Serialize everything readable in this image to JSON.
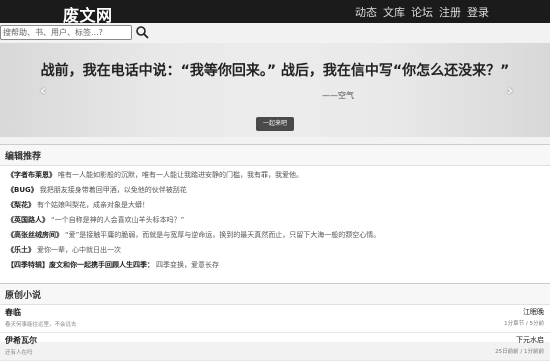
{
  "header": {
    "brand": "废文网",
    "nav": [
      "动态",
      "文库",
      "论坛",
      "注册",
      "登录"
    ]
  },
  "search": {
    "placeholder": "搜帮助、书、用户、标签...?"
  },
  "hero": {
    "quote": "战前，我在电话中说：“我等你回来。” 战后，我在信中写“你怎么还没来？”",
    "author": "——空气",
    "button": "一起来吧",
    "prev_arrow": "‹",
    "next_arrow": "›"
  },
  "recommend": {
    "heading": "编辑推荐",
    "items": [
      {
        "title": "《字者布莱恩》",
        "desc": "唯有一人能如影般的沉默，唯有一人能让我踏进安静的门槛，我有罪，我爱他。"
      },
      {
        "title": "《BUG》",
        "desc": "我把朋友接身带着回甲酒，以免他的伙伴被刮花"
      },
      {
        "title": "《梨花》",
        "desc": "有个姑娘叫梨花，成亲对象是大蟒！"
      },
      {
        "title": "《英国路人》",
        "desc": "“一个自称是神的人会喜欢山羊头标本吗？”"
      },
      {
        "title": "《高张丝绒房间》",
        "desc": "“爱”是接触平庸的脆弱，而就是与宽厚与逆命运，换到的最天真然而止，只留下大海一般的颓空心情。"
      },
      {
        "title": "《乐土》",
        "desc": "爱你一辈，心中就日出一次"
      },
      {
        "title": "【四季特辑】废文和你一起携手回顾人生四季：",
        "desc": "四季变换，爱意长存"
      }
    ]
  },
  "novels": {
    "heading": "原创小说",
    "items": [
      {
        "title": "春临",
        "desc": "春天何事能往远里，不会远去",
        "author": "江眠晚",
        "stats": "1分章节 / 5分前"
      },
      {
        "title": "伊希瓦尔",
        "desc": "还有人在吗",
        "author": "下元水启",
        "stats": "25日前前 / 1分前前"
      }
    ]
  }
}
